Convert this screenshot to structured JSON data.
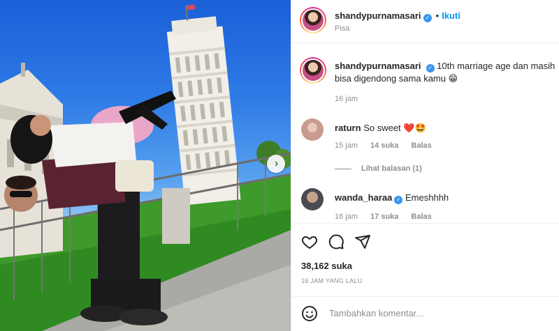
{
  "post": {
    "author": "shandypurnamasari",
    "follow_label": "Ikuti",
    "separator": "•",
    "location": "Pisa",
    "verified_glyph": "✓",
    "carousel_next_glyph": "›"
  },
  "caption": {
    "author": "shandypurnamasari",
    "text": "10th marriage age dan masih bisa digendong sama kamu 😁",
    "time": "16 jam"
  },
  "comments": [
    {
      "author": "raturn",
      "text": "So sweet ❤️🤩",
      "time": "15 jam",
      "likes": "14 suka",
      "reply_label": "Balas",
      "view_replies": "Lihat balasan (1)",
      "avatar_color": "#c99a8e",
      "verified": false
    },
    {
      "author": "wanda_haraa",
      "text": "Emeshhhh",
      "time": "16 jam",
      "likes": "17 suka",
      "reply_label": "Balas",
      "avatar_color": "#4a4a52",
      "verified": true
    }
  ],
  "actions": {
    "like_icon": "heart-icon",
    "comment_icon": "comment-icon",
    "share_icon": "paper-plane-icon",
    "likes_count": "38,162 suka",
    "posted_ago": "16 JAM YANG LALU"
  },
  "composer": {
    "placeholder": "Tambahkan komentar...",
    "value": "",
    "emoji_icon": "smiley-icon"
  },
  "colors": {
    "link_blue": "#0095f6",
    "verified_blue": "#3897f0",
    "muted_text": "#8e8e8e",
    "divider": "#efefef"
  }
}
